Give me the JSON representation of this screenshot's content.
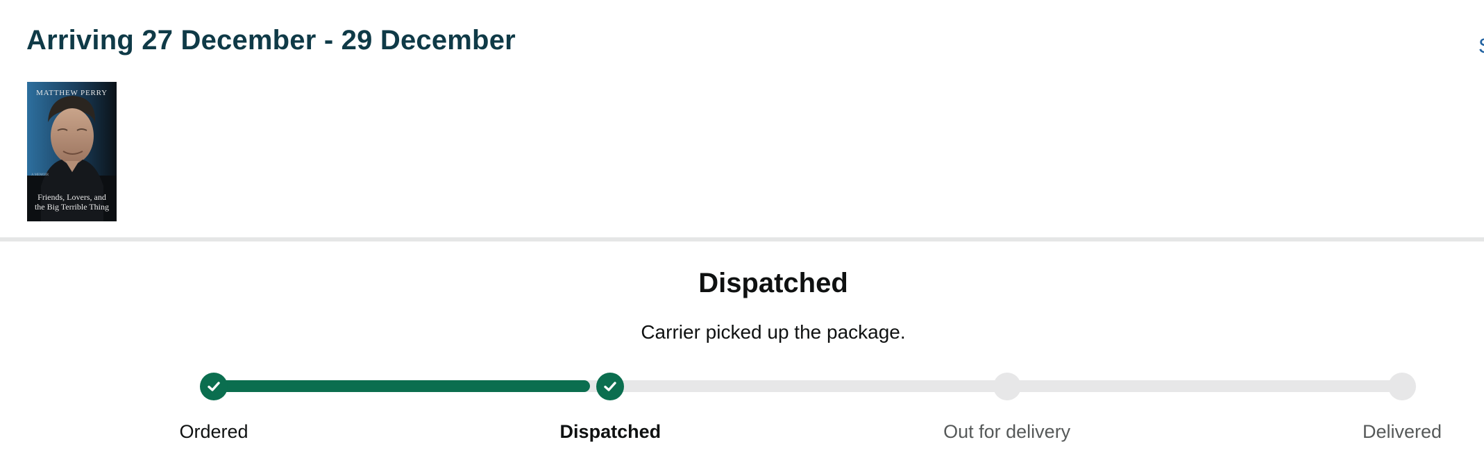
{
  "header": {
    "arrival_title": "Arriving 27 December - 29 December",
    "edge_link_text": "S"
  },
  "product": {
    "cover": {
      "author": "MATTHEW PERRY",
      "memoir_label": "A MEMOIR",
      "subtitle_line1": "Friends, Lovers, and",
      "subtitle_line2": "the Big Terrible Thing"
    }
  },
  "shipment": {
    "status_title": "Dispatched",
    "status_detail": "Carrier picked up the package.",
    "progress_fraction": 0.316,
    "steps": [
      {
        "label": "Ordered",
        "state": "done"
      },
      {
        "label": "Dispatched",
        "state": "current"
      },
      {
        "label": "Out for delivery",
        "state": "pending"
      },
      {
        "label": "Delivered",
        "state": "pending"
      }
    ]
  },
  "colors": {
    "title": "#0f3a47",
    "progress_complete": "#0b6e4f",
    "progress_track": "#e7e7e8",
    "link": "#2162a1"
  },
  "icons": {
    "step_complete": "check-icon"
  }
}
